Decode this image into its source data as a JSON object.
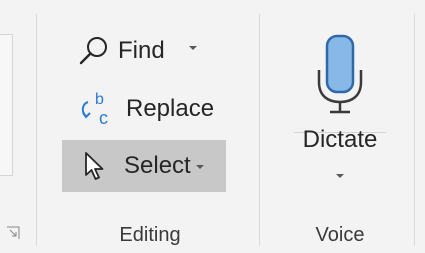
{
  "editing": {
    "find_label": "Find",
    "replace_label": "Replace",
    "replace_icon_letters": {
      "top": "b",
      "bottom": "c"
    },
    "select_label": "Select",
    "group_label": "Editing"
  },
  "voice": {
    "dictate_label": "Dictate",
    "group_label": "Voice"
  },
  "colors": {
    "mic_fill": "#87b8e8",
    "mic_outline": "#2f6aa8",
    "replace_b": "#2b7cd3",
    "replace_c": "#2b7cd3",
    "select_highlight": "#c8c8c8"
  },
  "icons": {
    "find": "magnifier-icon",
    "replace": "replace-icon",
    "select": "cursor-icon",
    "dictate": "microphone-icon",
    "launcher": "dialog-launcher-icon"
  }
}
